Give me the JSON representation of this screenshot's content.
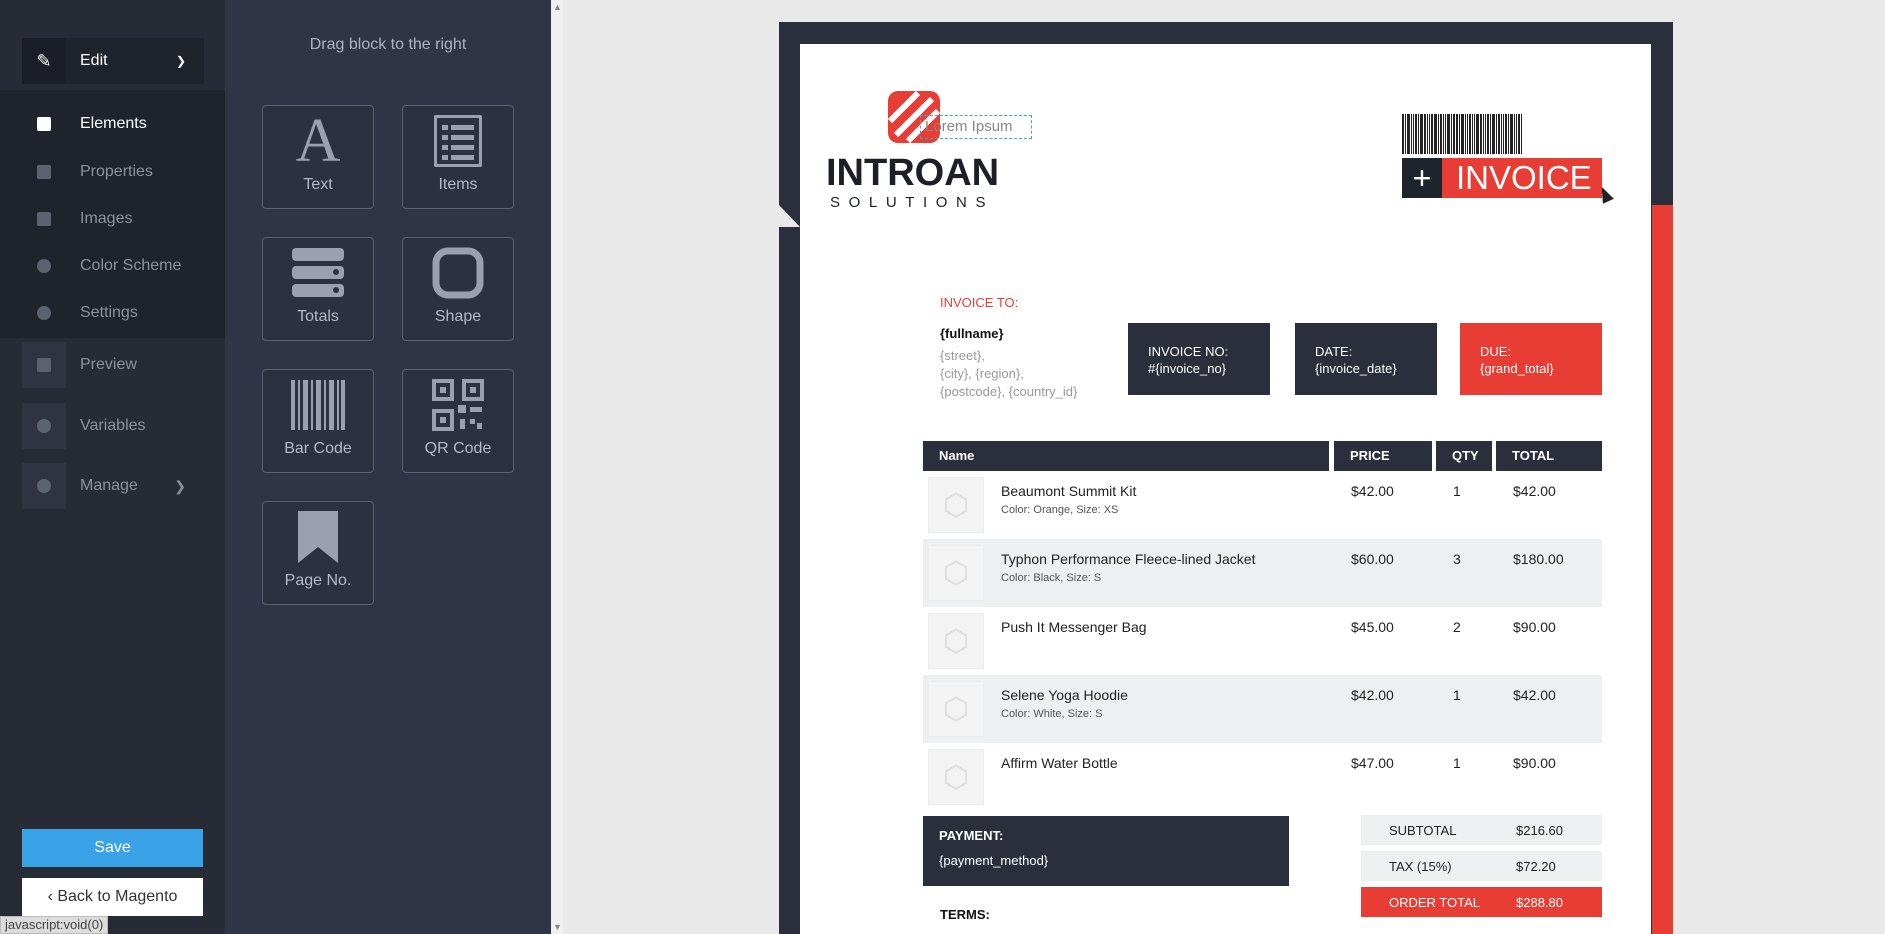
{
  "nav": {
    "edit_label": "Edit",
    "items": [
      {
        "label": "Elements"
      },
      {
        "label": "Properties"
      },
      {
        "label": "Images"
      },
      {
        "label": "Color Scheme"
      },
      {
        "label": "Settings"
      },
      {
        "label": "Preview"
      },
      {
        "label": "Variables"
      },
      {
        "label": "Manage"
      }
    ],
    "save_label": "Save",
    "back_label": "Back to Magento",
    "status": "javascript:void(0)"
  },
  "blocks": {
    "hint": "Drag block to the right",
    "items": [
      {
        "label": "Text",
        "icon": "text-icon"
      },
      {
        "label": "Items",
        "icon": "list-icon"
      },
      {
        "label": "Totals",
        "icon": "totals-icon"
      },
      {
        "label": "Shape",
        "icon": "shape-icon"
      },
      {
        "label": "Bar Code",
        "icon": "barcode-icon"
      },
      {
        "label": "QR Code",
        "icon": "qrcode-icon"
      },
      {
        "label": "Page No.",
        "icon": "bookmark-icon"
      }
    ]
  },
  "invoice": {
    "lorem": "Lorem Ipsum",
    "brand": "INTROAN",
    "brand_sub": "SOLUTIONS",
    "title": "INVOICE",
    "plus": "+",
    "invoice_to": "INVOICE TO:",
    "fullname": "{fullname}",
    "addr1": "{street},",
    "addr2": "{city}, {region},",
    "addr3": "{postcode}, {country_id}",
    "boxes": [
      {
        "l1": "INVOICE NO:",
        "l2": "#{invoice_no}"
      },
      {
        "l1": "DATE:",
        "l2": "{invoice_date}"
      },
      {
        "l1": "DUE:",
        "l2": "{grand_total}"
      }
    ],
    "headers": {
      "name": "Name",
      "price": "PRICE",
      "qty": "QTY",
      "total": "TOTAL"
    },
    "rows": [
      {
        "name": "Beaumont Summit Kit",
        "opt": "Color: Orange, Size: XS",
        "price": "$42.00",
        "qty": "1",
        "total": "$42.00"
      },
      {
        "name": "Typhon Performance Fleece-lined Jacket",
        "opt": "Color: Black, Size: S",
        "price": "$60.00",
        "qty": "3",
        "total": "$180.00"
      },
      {
        "name": "Push It Messenger Bag",
        "opt": "",
        "price": "$45.00",
        "qty": "2",
        "total": "$90.00"
      },
      {
        "name": "Selene Yoga Hoodie",
        "opt": "Color: White, Size: S",
        "price": "$42.00",
        "qty": "1",
        "total": "$42.00"
      },
      {
        "name": "Affirm Water Bottle",
        "opt": "",
        "price": "$47.00",
        "qty": "1",
        "total": "$90.00"
      }
    ],
    "payment_label": "PAYMENT:",
    "payment_method": "{payment_method}",
    "totals": [
      {
        "label": "SUBTOTAL",
        "value": "$216.60"
      },
      {
        "label": "TAX (15%)",
        "value": "$72.20"
      },
      {
        "label": "ORDER TOTAL",
        "value": "$288.80"
      }
    ],
    "terms": "TERMS:"
  },
  "colors": {
    "accent": "#e73d35",
    "dark": "#2b2f3b",
    "save": "#3aa3e8"
  }
}
